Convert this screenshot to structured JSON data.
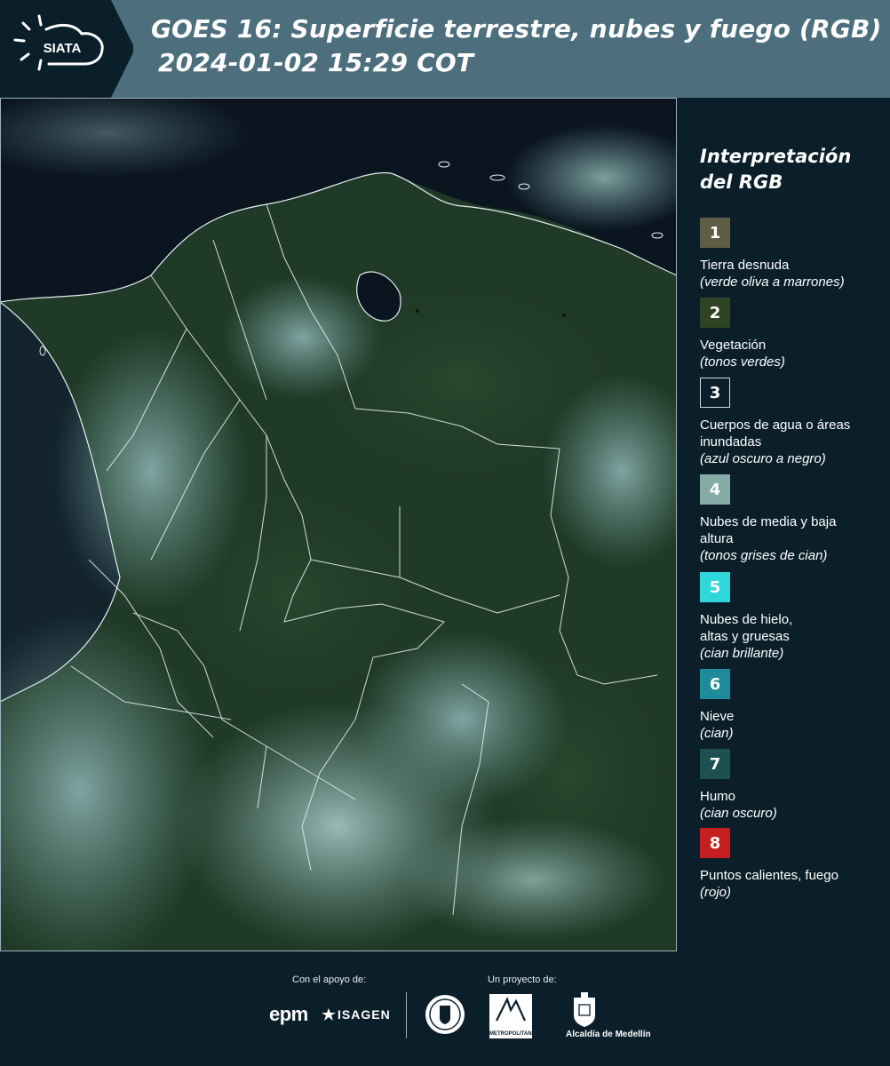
{
  "header": {
    "logo_text": "SIATA",
    "title_line1": "GOES 16: Superficie terrestre, nubes y fuego (RGB)",
    "title_line2": "2024-01-02 15:29 COT"
  },
  "map": {
    "colors": {
      "ocean": "#0b1520",
      "vegetation": "#1f3a26",
      "cloud": "#6f9a98",
      "border_line": "#e6eef2"
    }
  },
  "legend": {
    "title": "Interpretación del RGB",
    "items": [
      {
        "number": "1",
        "color": "#5e5e45",
        "label": "Tierra desnuda",
        "hint": "(verde oliva a marrones)"
      },
      {
        "number": "2",
        "color": "#2e4422",
        "label": "Vegetación",
        "hint": "(tonos verdes)"
      },
      {
        "number": "3",
        "color": "#0b1f2b",
        "label": "Cuerpos de agua o áreas inundadas",
        "hint": "(azul oscuro a negro)"
      },
      {
        "number": "4",
        "color": "#86aaa6",
        "label": "Nubes de media y baja altura",
        "hint": "(tonos grises de cian)"
      },
      {
        "number": "5",
        "color": "#2ed7dc",
        "label": "Nubes de hielo, altas y gruesas",
        "hint": "(cian brillante)"
      },
      {
        "number": "6",
        "color": "#1f8a9a",
        "label": "Nieve",
        "hint": "(cian)"
      },
      {
        "number": "7",
        "color": "#1e5052",
        "label": "Humo",
        "hint": "(cian oscuro)"
      },
      {
        "number": "8",
        "color": "#c41e1e",
        "label": "Puntos calientes, fuego",
        "hint": "(rojo)"
      }
    ]
  },
  "footer": {
    "support_label": "Con el apoyo de:",
    "project_label": "Un proyecto de:",
    "sponsors": [
      "epm",
      "ISAGEN"
    ],
    "partners": [
      "METROPOLITANA",
      "Alcaldía de Medellín"
    ]
  }
}
